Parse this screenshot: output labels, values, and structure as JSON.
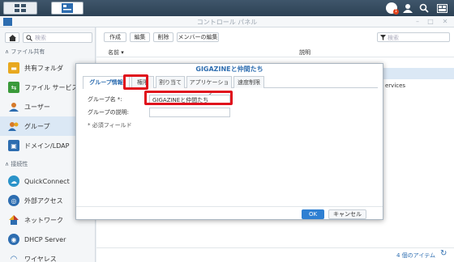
{
  "window": {
    "title": "コントロール パネル"
  },
  "sidebar": {
    "search_placeholder": "検索",
    "section_file": "ファイル共有",
    "section_connect": "接続性",
    "items": [
      {
        "label": "共有フォルダ",
        "icon": "folder-icon",
        "color": "#e8a81e"
      },
      {
        "label": "ファイル サービス",
        "icon": "file-services-icon",
        "color": "#3a9a3a"
      },
      {
        "label": "ユーザー",
        "icon": "user-icon",
        "color": "#d67a2a"
      },
      {
        "label": "グループ",
        "icon": "group-icon",
        "color": "#d67a2a"
      },
      {
        "label": "ドメイン/LDAP",
        "icon": "domain-icon",
        "color": "#2d6db0"
      },
      {
        "label": "QuickConnect",
        "icon": "quickconnect-icon",
        "color": "#2a93c9"
      },
      {
        "label": "外部アクセス",
        "icon": "globe-icon",
        "color": "#2d6db0"
      },
      {
        "label": "ネットワーク",
        "icon": "network-icon",
        "color": "#c0392b"
      },
      {
        "label": "DHCP Server",
        "icon": "dhcp-icon",
        "color": "#2d6db0"
      },
      {
        "label": "ワイヤレス",
        "icon": "wifi-icon",
        "color": "#2d6db0"
      }
    ]
  },
  "toolbar": {
    "create": "作成",
    "edit": "編集",
    "delete": "削除",
    "edit_members": "メンバーの編集",
    "filter_placeholder": "検索"
  },
  "table": {
    "col_name": "名前",
    "col_desc": "説明",
    "visible_fragment": "ervices"
  },
  "footer": {
    "count": "4 個のアイテム",
    "refresh_icon": "refresh-icon"
  },
  "dialog": {
    "title": "GIGAZINEと仲間たち",
    "tabs": [
      "グループ情報",
      "権限",
      "割り当て",
      "アプリケーション",
      "速度制限"
    ],
    "active_tab": 0,
    "group_name_label": "グループ名 *:",
    "group_name_value": "GIGAZINEと仲間たち",
    "desc_label": "グループの説明:",
    "desc_value": "",
    "required_note": "* 必須フィールド",
    "ok": "OK",
    "cancel": "キャンセル"
  },
  "colors": {
    "accent": "#2d6db0",
    "highlight": "#e0101c",
    "primary_button": "#2e7fd2"
  }
}
